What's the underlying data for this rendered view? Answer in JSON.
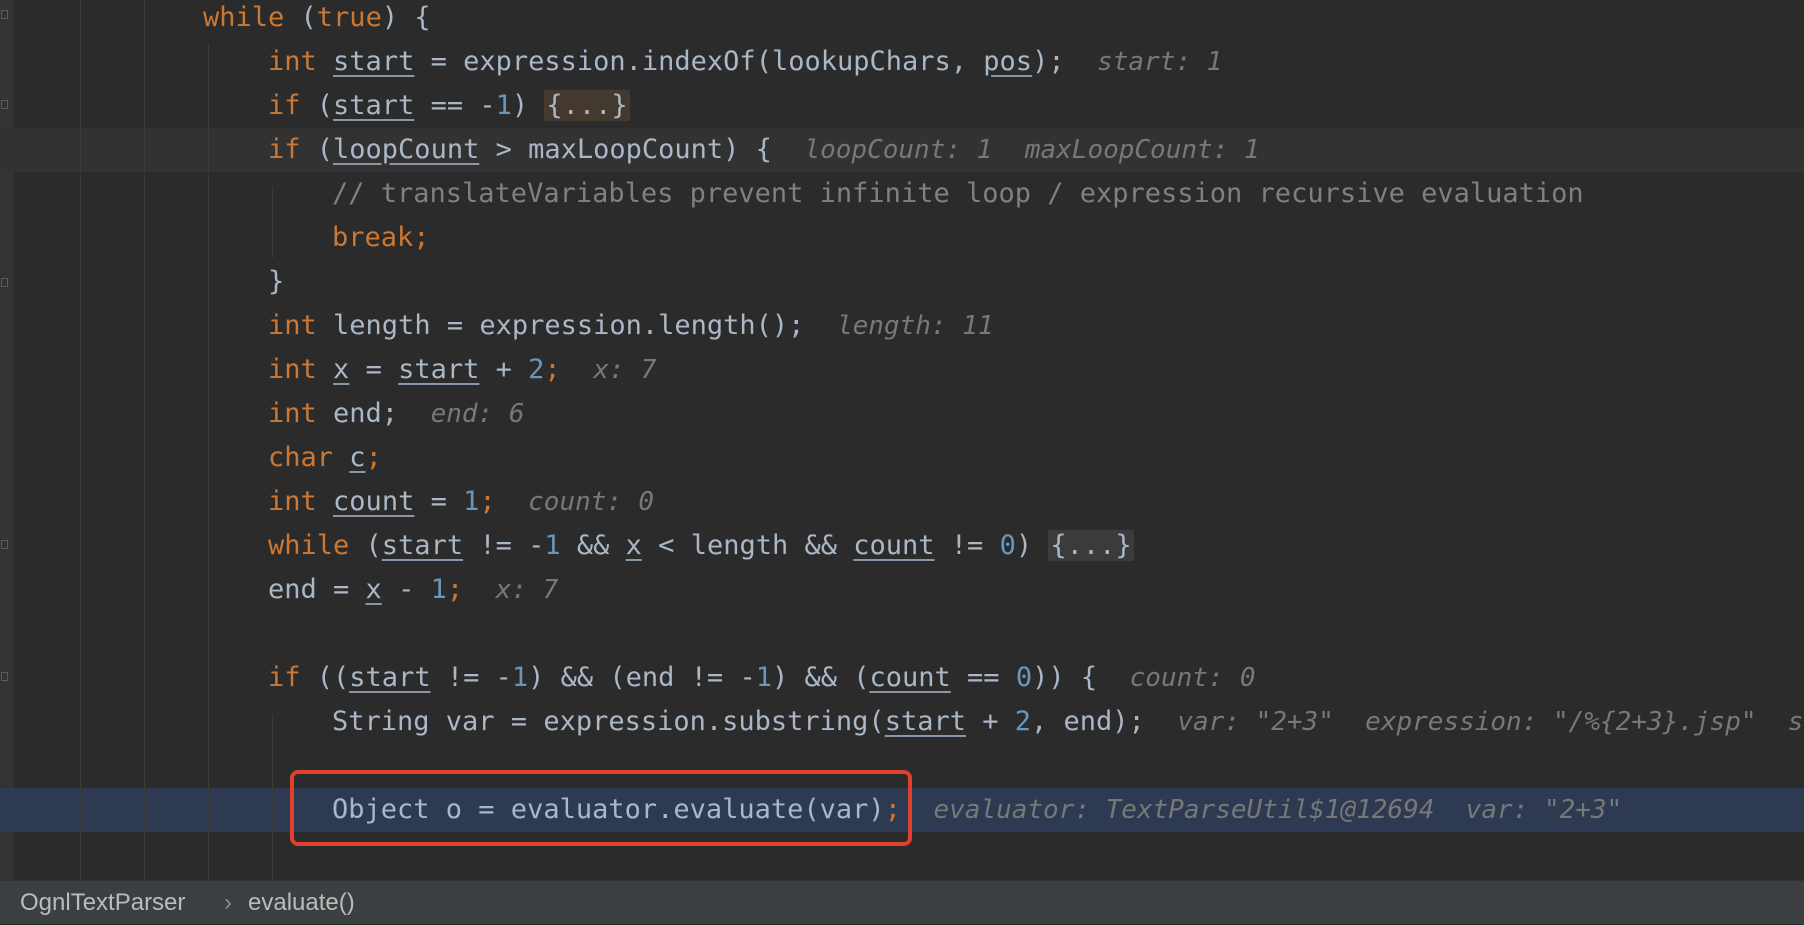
{
  "code": {
    "l1": {
      "kw": "while",
      "rest": " (",
      "kw2": "true",
      "rest2": ") {"
    },
    "l2": {
      "kw": "int",
      "var": "start",
      "rest": " = expression.indexOf(lookupChars, ",
      "var2": "pos",
      "rest2": ");",
      "hint": "start: 1"
    },
    "l3": {
      "kw": "if",
      "open": " (",
      "var": "start",
      "rest": " == -",
      "num": "1",
      "close": ") ",
      "folded": "{...}"
    },
    "l4": {
      "kw": "if",
      "open": " (",
      "var": "loopCount",
      "rest": " > maxLoopCount) {",
      "hint1": "loopCount: 1",
      "hint2": "maxLoopCount: 1"
    },
    "l5": {
      "comment": "// translateVariables prevent infinite loop / expression recursive evaluation"
    },
    "l6": {
      "kw": "break",
      "rest": ";"
    },
    "l7": {
      "text": "}"
    },
    "l8": {
      "kw": "int",
      "rest": " length = expression.length();",
      "hint": "length: 11"
    },
    "l9": {
      "kw": "int",
      "var": "x",
      "mid": " = ",
      "var2": "start",
      "rest": " + ",
      "num": "2",
      "end": ";",
      "hint_label": "x:",
      "hint_val": "7"
    },
    "l10": {
      "kw": "int",
      "rest": " end;",
      "hint": "end: 6"
    },
    "l11": {
      "kw": "char",
      "var": "c",
      "rest": ";"
    },
    "l12": {
      "kw": "int",
      "var": "count",
      "rest": " = ",
      "num": "1",
      "end": ";",
      "hint_label": "count:",
      "hint_val": "0"
    },
    "l13": {
      "kw": "while",
      "open": " (",
      "var": "start",
      "a": " != -",
      "n1": "1",
      "b": " && ",
      "var2": "x",
      "c": " < length && ",
      "var3": "count",
      "d": " != ",
      "n2": "0",
      "e": ") ",
      "folded": "{...}"
    },
    "l14": {
      "rest": "end = ",
      "var": "x",
      "mid": " - ",
      "num": "1",
      "end": ";",
      "hint": "x: 7"
    },
    "l15": {
      "kw": "if",
      "a": " ((",
      "var": "start",
      "b": " != -",
      "n1": "1",
      "c": ") && (end != -",
      "n2": "1",
      "d": ") && (",
      "var2": "count",
      "e": " == ",
      "n3": "0",
      "f": ")) {",
      "hint_label": "count:",
      "hint_val": "0"
    },
    "l16": {
      "rest": "String var = expression.substring(",
      "var": "start",
      "mid": " + ",
      "num": "2",
      "end": ", end);",
      "hint": "var: \"2+3\"  expression: \"/%{2+3}.jsp\"  s"
    },
    "l17": {
      "rest": "Object o = evaluator.evaluate(var)",
      "end": ";",
      "hint": "evaluator: TextParseUtil$1@12694  var: \"2+3\""
    }
  },
  "statusbar": {
    "class_name": "OgnlTextParser",
    "separator": "›",
    "method_name": "evaluate()"
  },
  "colors": {
    "background": "#2b2b2b",
    "keyword": "#cc7832",
    "number": "#6897bb",
    "text": "#a9b7c6",
    "hint": "#787878",
    "execution_line": "#2d3a52",
    "highlight_box": "#e0402e"
  }
}
